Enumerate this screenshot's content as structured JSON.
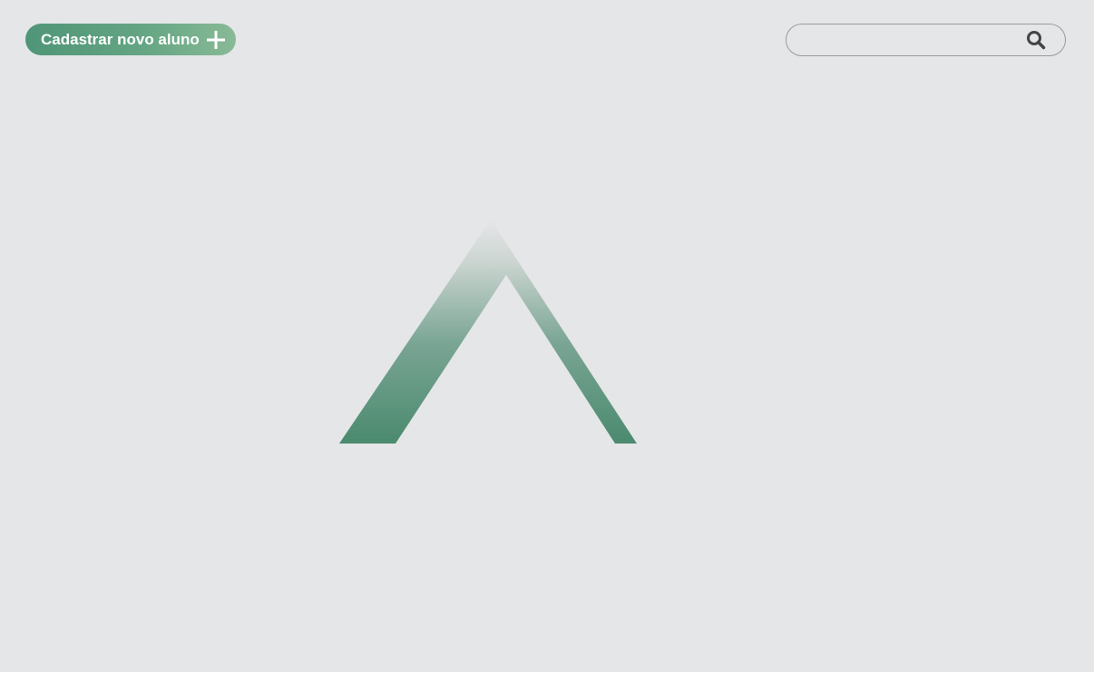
{
  "toolbar": {
    "add_student_label": "Cadastrar novo aluno",
    "add_icon": "plus-icon"
  },
  "search": {
    "value": "",
    "placeholder": "",
    "icon": "search-icon"
  },
  "logo": {
    "icon": "chevron-up-logo",
    "gradient_top": "#e5e6e8",
    "gradient_bottom": "#4a8a6e"
  },
  "colors": {
    "background": "#e5e6e8",
    "accent": "#5a9e7e",
    "accent_light": "#88ba96"
  }
}
